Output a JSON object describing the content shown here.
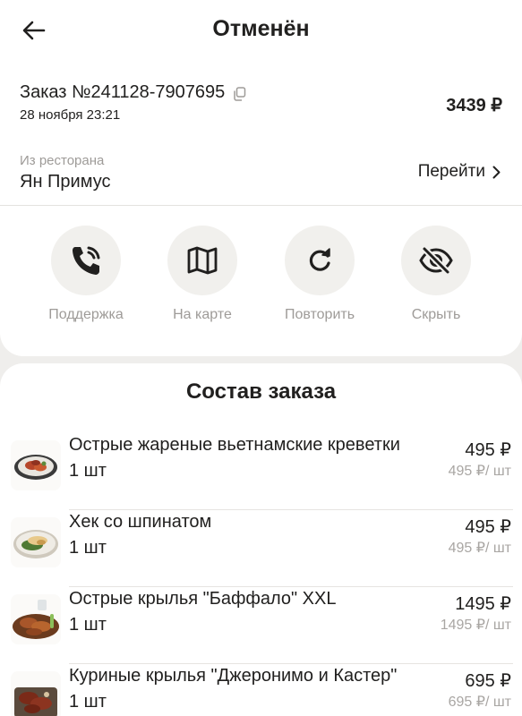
{
  "header": {
    "title": "Отменён"
  },
  "order": {
    "number": "Заказ №241128-7907695",
    "date": "28 ноября 23:21",
    "total": "3439 ₽"
  },
  "restaurant": {
    "caption": "Из ресторана",
    "name": "Ян Примус",
    "goto_label": "Перейти"
  },
  "actions": [
    {
      "label": "Поддержка",
      "icon": "phone-icon"
    },
    {
      "label": "На карте",
      "icon": "map-icon"
    },
    {
      "label": "Повторить",
      "icon": "repeat-icon"
    },
    {
      "label": "Скрыть",
      "icon": "eye-off-icon"
    }
  ],
  "composition": {
    "title": "Состав заказа",
    "items": [
      {
        "name": "Острые жареные вьетнамские креветки",
        "qty": "1 шт",
        "price": "495 ₽",
        "unit_price": "495 ₽/ шт"
      },
      {
        "name": "Хек со шпинатом",
        "qty": "1 шт",
        "price": "495 ₽",
        "unit_price": "495 ₽/ шт"
      },
      {
        "name": "Острые крылья \"Баффало\" XXL",
        "qty": "1 шт",
        "price": "1495 ₽",
        "unit_price": "1495 ₽/ шт"
      },
      {
        "name": "Куриные крылья \"Джеронимо и Кастер\"",
        "qty": "1 шт",
        "price": "695 ₽",
        "unit_price": "695 ₽/ шт"
      }
    ]
  }
}
